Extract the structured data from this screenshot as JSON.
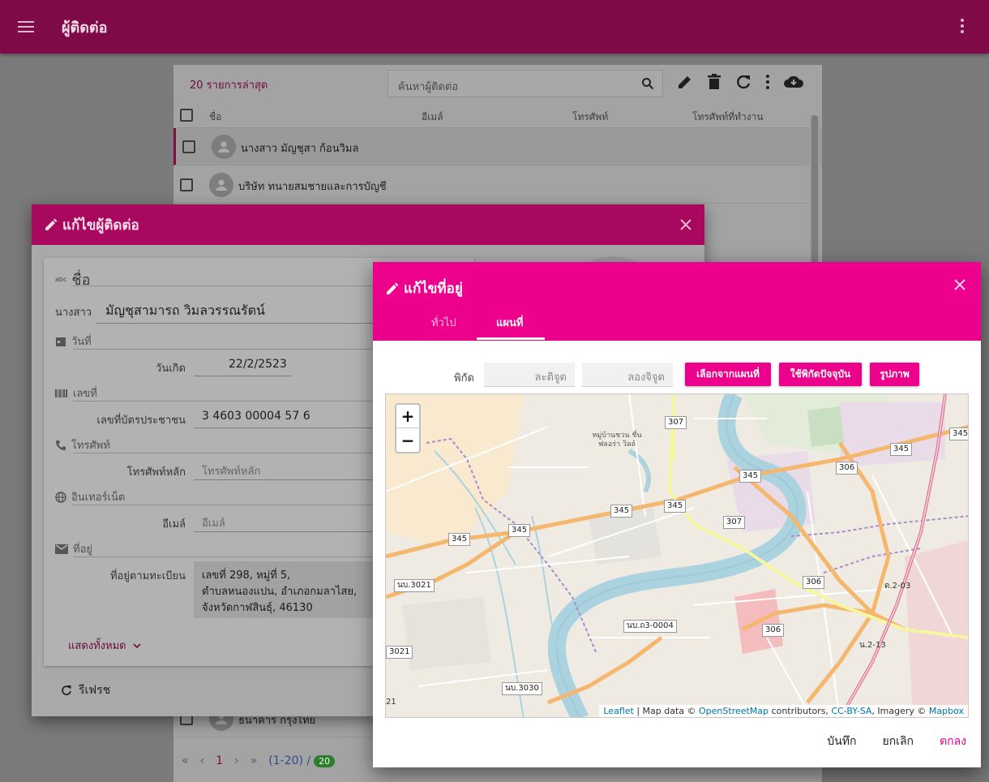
{
  "appbar": {
    "title": "ผู้ติดต่อ"
  },
  "list": {
    "recent_label": "20 รายการล่าสุด",
    "search_placeholder": "ค้นหาผู้ติดต่อ",
    "columns": [
      "ชื่อ",
      "อีเมล์",
      "โทรศัพท์",
      "โทรศัพท์ที่ทำงาน"
    ],
    "rows": [
      {
        "name": "นางสาว มัญชุสา ก้อนวิมล"
      },
      {
        "name": "บริษัท ทนายสมชายและการบัญชี"
      },
      {
        "name": "ธนาคาร กรุงไทย"
      }
    ],
    "pager": {
      "current": "1",
      "range": "(1-20) /",
      "total": "20"
    }
  },
  "contact_dialog": {
    "title": "แก้ไขผู้ติดต่อ",
    "sections": {
      "name": "ชื่อ",
      "date": "วันที่",
      "number": "เลขที่",
      "phone": "โทรศัพท์",
      "internet": "อินเทอร์เน็ต",
      "address": "ที่อยู่"
    },
    "fields": {
      "title_prefix": "นางสาว",
      "full_name": "มัญชุสามารถ วิมลวรรณรัตน์",
      "birthday_label": "วันเกิด",
      "birthday_value": "22/2/2523",
      "id_card_label": "เลขที่บัตรประชาชน",
      "id_card_value": "3 4603 00004 57 6",
      "main_phone_label": "โทรศัพท์หลัก",
      "main_phone_placeholder": "โทรศัพท์หลัก",
      "email_label": "อีเมล์",
      "email_placeholder": "อีเมล์",
      "registered_address_label": "ที่อยู่ตามทะเบียน",
      "registered_address_line1": "เลขที่ 298, หมู่ที่ 5,",
      "registered_address_line2": "ตำบลหนองแปน, อำเภอกมลาไสย,",
      "registered_address_line3": "จังหวัดกาฬสินธุ์, 46130"
    },
    "show_all": "แสดงทั้งหมด",
    "refresh": "รีเฟรช"
  },
  "address_dialog": {
    "title": "แก้ไขที่อยู่",
    "tabs": [
      "ทั่วไป",
      "แผนที่"
    ],
    "coord_label": "พิกัด",
    "lat_placeholder": "ละติจูด",
    "lng_placeholder": "ลองจิจูด",
    "buttons": {
      "pick_map": "เลือกจากแผนที่",
      "use_current": "ใช้พิกัดปัจจุบัน",
      "image": "รูปภาพ"
    },
    "map": {
      "zoom_in": "+",
      "zoom_out": "−",
      "road_labels": [
        "307",
        "345",
        "345",
        "345",
        "345",
        "345",
        "345",
        "345",
        "306",
        "306",
        "306",
        "307",
        "นบ.3021",
        "3021",
        "นบ.ถ3-0004",
        "นบ.3030",
        "ด.2-03",
        "น.2-13",
        "21"
      ],
      "place_label": "หมู่บ้านชวน ชื่นฟลอร่า วิลล์",
      "attribution": {
        "leaflet": "Leaflet",
        "sep1": " | Map data © ",
        "osm": "OpenStreetMap",
        "sep2": " contributors, ",
        "license": "CC-BY-SA",
        "sep3": ", Imagery © ",
        "mapbox": "Mapbox"
      }
    },
    "actions": {
      "save": "บันทึก",
      "cancel": "ยกเลิก",
      "ok": "ตกลง"
    }
  },
  "colors": {
    "appbar": "#7e0b47",
    "dialog_header_dim": "#a8085e",
    "accent": "#ec008c",
    "link": "#0078a8"
  }
}
